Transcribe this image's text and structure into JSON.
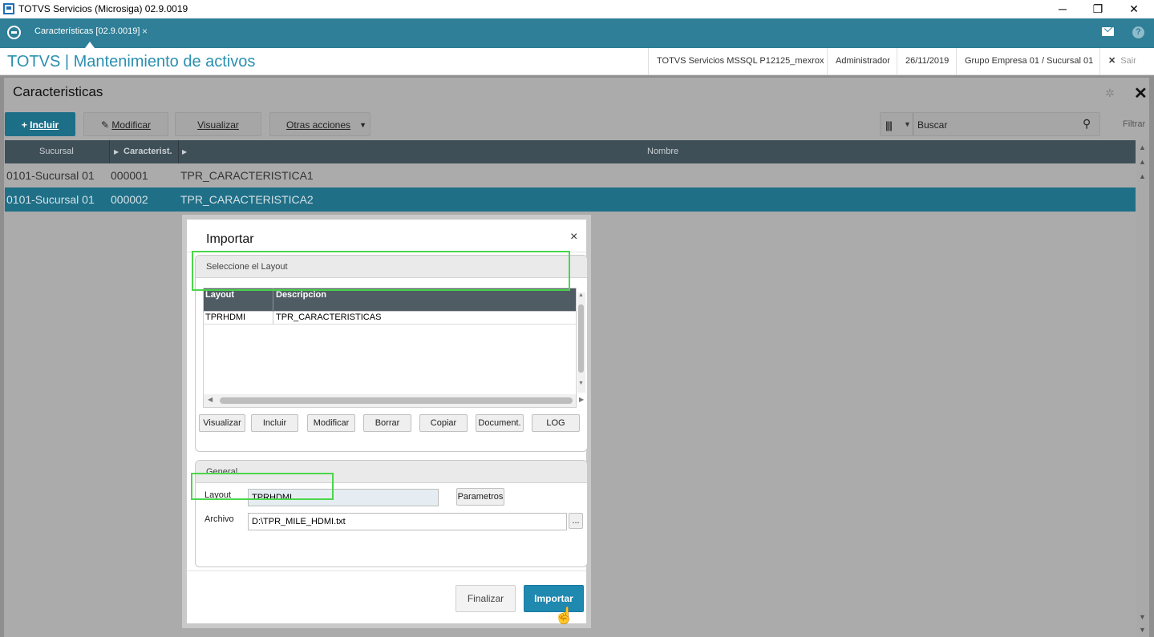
{
  "window": {
    "title": "TOTVS Servicios (Microsiga) 02.9.0019",
    "minimize": "─",
    "restore": "❐",
    "close": "✕"
  },
  "tabbar": {
    "tab_label": "Características [02.9.0019]",
    "tab_close": "×",
    "mail_icon": "mail-icon",
    "help_icon": "?"
  },
  "header": {
    "app_title": "TOTVS | Mantenimiento de activos",
    "environment": "TOTVS Servicios MSSQL P12125_mexrox",
    "user": "Administrador",
    "date": "26/11/2019",
    "company": "Grupo Empresa 01 / Sucursal 01",
    "logout": "Sair",
    "logout_icon": "✕"
  },
  "page": {
    "title": "Caracteristicas",
    "toolbar": {
      "incluir": "Incluir",
      "modificar": "Modificar",
      "visualizar": "Visualizar",
      "otras": "Otras acciones"
    },
    "search_placeholder": "Buscar",
    "filter_label": "Filtrar",
    "grid": {
      "columns": [
        "Sucursal",
        "Caracterist.",
        "Nombre"
      ],
      "rows": [
        {
          "sucursal": "0101-Sucursal 01",
          "codigo": "000001",
          "nombre": "TPR_CARACTERISTICA1"
        },
        {
          "sucursal": "0101-Sucursal 01",
          "codigo": "000002",
          "nombre": "TPR_CARACTERISTICA2"
        }
      ]
    }
  },
  "dialog": {
    "title": "Importar",
    "close": "×",
    "layout_section": {
      "label": "Seleccione el Layout",
      "columns": [
        "Layout",
        "Descripcion"
      ],
      "rows": [
        {
          "layout": "TPRHDMI",
          "descripcion": "TPR_CARACTERISTICAS"
        }
      ],
      "buttons": [
        "Visualizar",
        "Incluir",
        "Modificar",
        "Borrar",
        "Copiar",
        "Document.",
        "LOG"
      ]
    },
    "general_section": {
      "label": "General",
      "layout_label": "Layout",
      "layout_value": "TPRHDMI",
      "parametros": "Parametros",
      "archivo_label": "Archivo",
      "archivo_value": "D:\\TPR_MILE_HDMI.txt",
      "browse": "..."
    },
    "finalizar": "Finalizar",
    "importar": "Importar"
  },
  "colors": {
    "accent": "#2e7f97",
    "selected_row": "#1f6f87",
    "primary_button": "#1f89b0",
    "highlight": "#4bd64b"
  }
}
